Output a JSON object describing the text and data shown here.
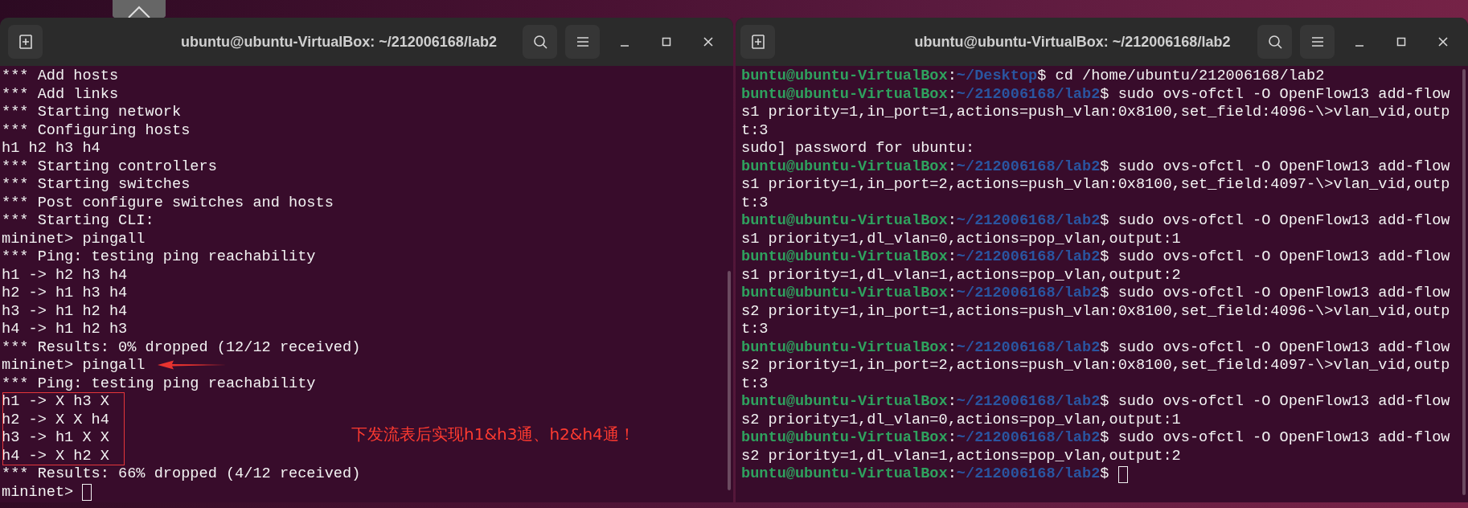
{
  "windows": [
    {
      "title": "ubuntu@ubuntu-VirtualBox: ~/212006168/lab2",
      "cursor": true,
      "annotation": {
        "note": "下发流表后实现h1&h3通、h2&h4通！"
      },
      "lines": [
        {
          "kind": "plain",
          "text": "*** Add hosts"
        },
        {
          "kind": "plain",
          "text": "*** Add links"
        },
        {
          "kind": "plain",
          "text": "*** Starting network"
        },
        {
          "kind": "plain",
          "text": "*** Configuring hosts"
        },
        {
          "kind": "plain",
          "text": "h1 h2 h3 h4"
        },
        {
          "kind": "plain",
          "text": "*** Starting controllers"
        },
        {
          "kind": "plain",
          "text": "*** Starting switches"
        },
        {
          "kind": "plain",
          "text": "*** Post configure switches and hosts"
        },
        {
          "kind": "plain",
          "text": "*** Starting CLI:"
        },
        {
          "kind": "plain",
          "text": "mininet> pingall"
        },
        {
          "kind": "plain",
          "text": "*** Ping: testing ping reachability"
        },
        {
          "kind": "plain",
          "text": "h1 -> h2 h3 h4"
        },
        {
          "kind": "plain",
          "text": "h2 -> h1 h3 h4"
        },
        {
          "kind": "plain",
          "text": "h3 -> h1 h2 h4"
        },
        {
          "kind": "plain",
          "text": "h4 -> h1 h2 h3"
        },
        {
          "kind": "plain",
          "text": "*** Results: 0% dropped (12/12 received)"
        },
        {
          "kind": "plain",
          "text": "mininet> pingall"
        },
        {
          "kind": "plain",
          "text": "*** Ping: testing ping reachability"
        },
        {
          "kind": "plain",
          "text": "h1 -> X h3 X"
        },
        {
          "kind": "plain",
          "text": "h2 -> X X h4"
        },
        {
          "kind": "plain",
          "text": "h3 -> h1 X X"
        },
        {
          "kind": "plain",
          "text": "h4 -> X h2 X"
        },
        {
          "kind": "plain",
          "text": "*** Results: 66% dropped (4/12 received)"
        },
        {
          "kind": "plain",
          "text": "mininet> "
        }
      ]
    },
    {
      "title": "ubuntu@ubuntu-VirtualBox: ~/212006168/lab2",
      "cursor": true,
      "lines": [
        {
          "kind": "prompt",
          "user": "buntu@ubuntu-VirtualBox",
          "separator": ":",
          "path": "~/Desktop",
          "symbol": "$ ",
          "command": "cd /home/ubuntu/212006168/lab2"
        },
        {
          "kind": "prompt",
          "user": "buntu@ubuntu-VirtualBox",
          "separator": ":",
          "path": "~/212006168/lab2",
          "symbol": "$ ",
          "command": "sudo ovs-ofctl -O OpenFlow13 add-flow"
        },
        {
          "kind": "plain",
          "text": "s1 priority=1,in_port=1,actions=push_vlan:0x8100,set_field:4096-\\>vlan_vid,outp"
        },
        {
          "kind": "plain",
          "text": "t:3"
        },
        {
          "kind": "plain",
          "text": "sudo] password for ubuntu:"
        },
        {
          "kind": "prompt",
          "user": "buntu@ubuntu-VirtualBox",
          "separator": ":",
          "path": "~/212006168/lab2",
          "symbol": "$ ",
          "command": "sudo ovs-ofctl -O OpenFlow13 add-flow"
        },
        {
          "kind": "plain",
          "text": "s1 priority=1,in_port=2,actions=push_vlan:0x8100,set_field:4097-\\>vlan_vid,outp"
        },
        {
          "kind": "plain",
          "text": "t:3"
        },
        {
          "kind": "prompt",
          "user": "buntu@ubuntu-VirtualBox",
          "separator": ":",
          "path": "~/212006168/lab2",
          "symbol": "$ ",
          "command": "sudo ovs-ofctl -O OpenFlow13 add-flow"
        },
        {
          "kind": "plain",
          "text": "s1 priority=1,dl_vlan=0,actions=pop_vlan,output:1"
        },
        {
          "kind": "prompt",
          "user": "buntu@ubuntu-VirtualBox",
          "separator": ":",
          "path": "~/212006168/lab2",
          "symbol": "$ ",
          "command": "sudo ovs-ofctl -O OpenFlow13 add-flow"
        },
        {
          "kind": "plain",
          "text": "s1 priority=1,dl_vlan=1,actions=pop_vlan,output:2"
        },
        {
          "kind": "prompt",
          "user": "buntu@ubuntu-VirtualBox",
          "separator": ":",
          "path": "~/212006168/lab2",
          "symbol": "$ ",
          "command": "sudo ovs-ofctl -O OpenFlow13 add-flow"
        },
        {
          "kind": "plain",
          "text": "s2 priority=1,in_port=1,actions=push_vlan:0x8100,set_field:4096-\\>vlan_vid,outp"
        },
        {
          "kind": "plain",
          "text": "t:3"
        },
        {
          "kind": "prompt",
          "user": "buntu@ubuntu-VirtualBox",
          "separator": ":",
          "path": "~/212006168/lab2",
          "symbol": "$ ",
          "command": "sudo ovs-ofctl -O OpenFlow13 add-flow"
        },
        {
          "kind": "plain",
          "text": "s2 priority=1,in_port=2,actions=push_vlan:0x8100,set_field:4097-\\>vlan_vid,outp"
        },
        {
          "kind": "plain",
          "text": "t:3"
        },
        {
          "kind": "prompt",
          "user": "buntu@ubuntu-VirtualBox",
          "separator": ":",
          "path": "~/212006168/lab2",
          "symbol": "$ ",
          "command": "sudo ovs-ofctl -O OpenFlow13 add-flow"
        },
        {
          "kind": "plain",
          "text": "s2 priority=1,dl_vlan=0,actions=pop_vlan,output:1"
        },
        {
          "kind": "prompt",
          "user": "buntu@ubuntu-VirtualBox",
          "separator": ":",
          "path": "~/212006168/lab2",
          "symbol": "$ ",
          "command": "sudo ovs-ofctl -O OpenFlow13 add-flow"
        },
        {
          "kind": "plain",
          "text": "s2 priority=1,dl_vlan=1,actions=pop_vlan,output:2"
        },
        {
          "kind": "prompt",
          "user": "buntu@ubuntu-VirtualBox",
          "separator": ":",
          "path": "~/212006168/lab2",
          "symbol": "$ "
        }
      ]
    }
  ]
}
